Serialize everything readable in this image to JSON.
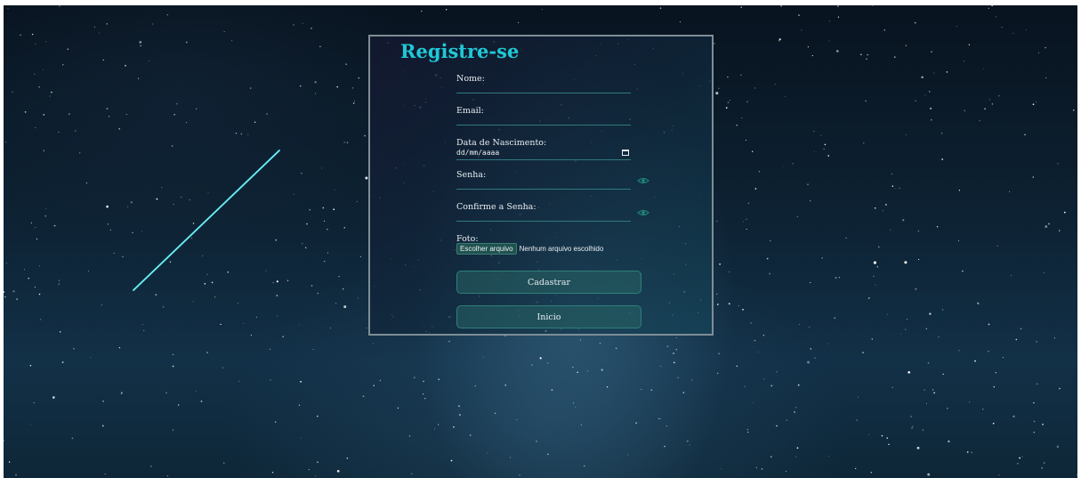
{
  "form": {
    "title": "Registre-se",
    "fields": {
      "nome": {
        "label": "Nome:"
      },
      "email": {
        "label": "Email:"
      },
      "nascimento": {
        "label": "Data de Nascimento:",
        "placeholder": "dd/mm/aaaa"
      },
      "senha": {
        "label": "Senha:"
      },
      "confirme": {
        "label": "Confirme a Senha:"
      },
      "foto": {
        "label": "Foto:",
        "button_label": "Escolher arquivo",
        "status": "Nenhum arquivo escolhido"
      }
    },
    "buttons": {
      "cadastrar": "Cadastrar",
      "inicio": "Inicio"
    }
  },
  "icons": {
    "date_picker": "calendar-icon",
    "password_toggle": "eye-icon"
  },
  "colors": {
    "accent": "#1fc9d6",
    "button_bg": "#1f5a5a",
    "field_underline": "#2f7a7e",
    "panel_border": "#7e8e96"
  }
}
